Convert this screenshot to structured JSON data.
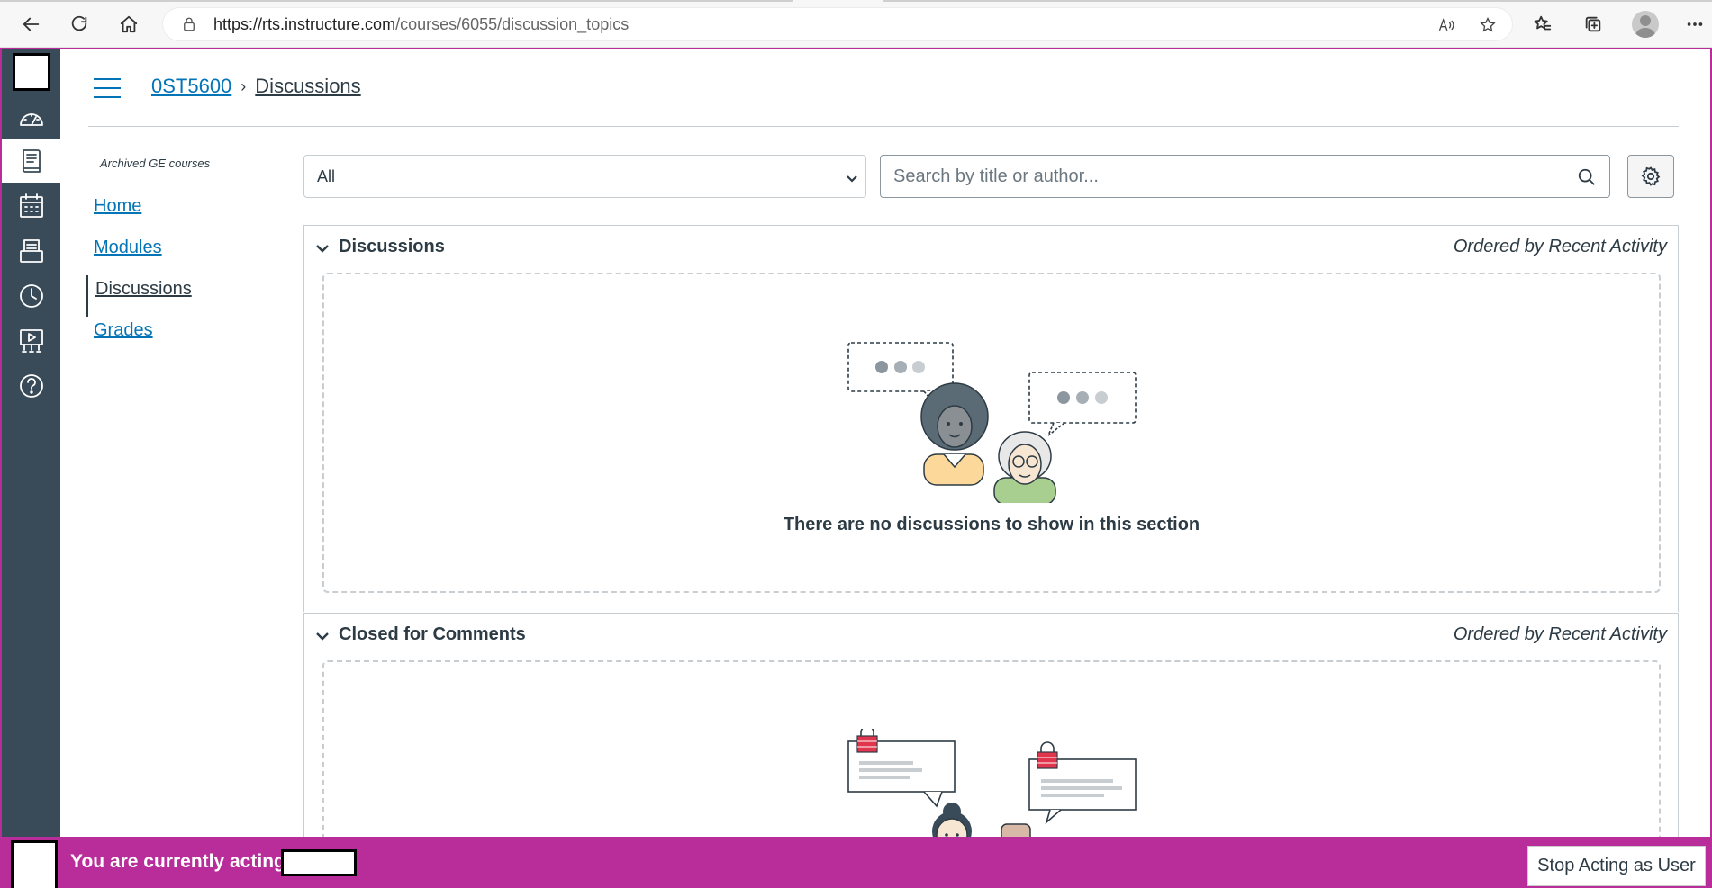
{
  "browser": {
    "url_host": "https://rts.instructure.com",
    "url_path": "/courses/6055/discussion_topics"
  },
  "breadcrumb": {
    "course": "0ST5600",
    "separator": "›",
    "current": "Discussions"
  },
  "course_nav": {
    "heading": "Archived GE courses",
    "items": [
      "Home",
      "Modules",
      "Discussions",
      "Grades"
    ]
  },
  "toolbar": {
    "filter_value": "All",
    "search_placeholder": "Search by title or author..."
  },
  "sections": [
    {
      "title": "Discussions",
      "order": "Ordered by Recent Activity",
      "empty_message": "There are no discussions to show in this section"
    },
    {
      "title": "Closed for Comments",
      "order": "Ordered by Recent Activity"
    }
  ],
  "acting_bar": {
    "message": "You are currently acting as",
    "stop_label": "Stop Acting as User"
  },
  "colors": {
    "brand_nav": "#394b58",
    "link": "#0374b5",
    "acting_bar": "#b92d9b"
  }
}
